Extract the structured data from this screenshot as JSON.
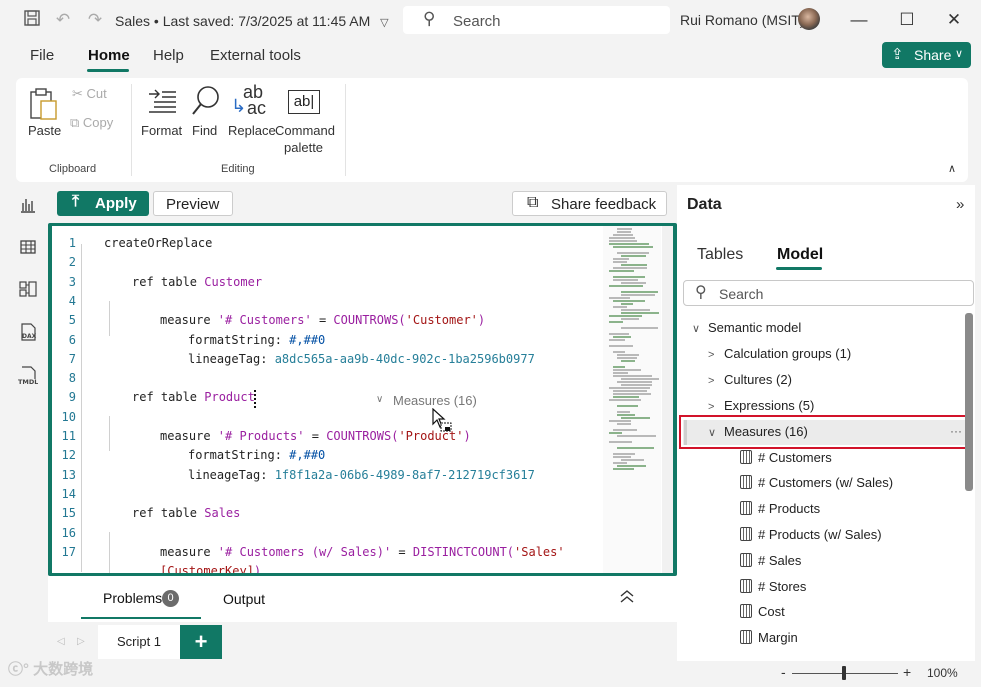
{
  "titlebar": {
    "title": "Sales • Last saved: 7/3/2025 at 11:45 AM",
    "dropdown_glyph": "▽",
    "search_placeholder": "Search",
    "user": "Rui Romano (MSIT)",
    "icons": [
      "save-icon",
      "undo-icon",
      "redo-icon",
      "search-icon",
      "avatar",
      "minimize-icon",
      "maximize-icon",
      "close-icon"
    ]
  },
  "menu": {
    "items": [
      "File",
      "Home",
      "Help",
      "External tools"
    ],
    "active": "Home",
    "share_label": "Share"
  },
  "ribbon": {
    "paste": "Paste",
    "cut": "Cut",
    "copy": "Copy",
    "clipboard_group": "Clipboard",
    "format": "Format",
    "find": "Find",
    "replace": "Replace",
    "command_palette_1": "Command",
    "command_palette_2": "palette",
    "editing_group": "Editing"
  },
  "toolbar": {
    "apply": "Apply",
    "preview": "Preview",
    "share_feedback": "Share feedback"
  },
  "editor": {
    "lines": [
      {
        "n": "1",
        "indent": 0,
        "parts": [
          [
            "kw",
            "createOrReplace"
          ]
        ]
      },
      {
        "n": "2",
        "indent": 0,
        "parts": []
      },
      {
        "n": "3",
        "indent": 1,
        "parts": [
          [
            "kw",
            "ref table "
          ],
          [
            "purple",
            "Customer"
          ]
        ]
      },
      {
        "n": "4",
        "indent": 0,
        "parts": []
      },
      {
        "n": "5",
        "indent": 2,
        "parts": [
          [
            "kw",
            "measure "
          ],
          [
            "purple",
            "'# Customers'"
          ],
          [
            "kw",
            " = "
          ],
          [
            "purple",
            "COUNTROWS("
          ],
          [
            "str",
            "'Customer'"
          ],
          [
            "purple",
            ")"
          ]
        ]
      },
      {
        "n": "6",
        "indent": 3,
        "parts": [
          [
            "kw",
            "formatString: "
          ],
          [
            "blue",
            "#,##0"
          ]
        ]
      },
      {
        "n": "7",
        "indent": 3,
        "parts": [
          [
            "kw",
            "lineageTag: "
          ],
          [
            "teal",
            "a8dc565a-aa9b-40dc-902c-1ba2596b0977"
          ]
        ]
      },
      {
        "n": "8",
        "indent": 0,
        "parts": []
      },
      {
        "n": "9",
        "indent": 1,
        "parts": [
          [
            "kw",
            "ref table "
          ],
          [
            "purple",
            "Product"
          ]
        ]
      },
      {
        "n": "10",
        "indent": 0,
        "parts": []
      },
      {
        "n": "11",
        "indent": 2,
        "parts": [
          [
            "kw",
            "measure "
          ],
          [
            "purple",
            "'# Products'"
          ],
          [
            "kw",
            " = "
          ],
          [
            "purple",
            "COUNTROWS("
          ],
          [
            "str",
            "'Product'"
          ],
          [
            "purple",
            ")"
          ]
        ]
      },
      {
        "n": "12",
        "indent": 3,
        "parts": [
          [
            "kw",
            "formatString: "
          ],
          [
            "blue",
            "#,##0"
          ]
        ]
      },
      {
        "n": "13",
        "indent": 3,
        "parts": [
          [
            "kw",
            "lineageTag: "
          ],
          [
            "teal",
            "1f8f1a2a-06b6-4989-8af7-212719cf3617"
          ]
        ]
      },
      {
        "n": "14",
        "indent": 0,
        "parts": []
      },
      {
        "n": "15",
        "indent": 1,
        "parts": [
          [
            "kw",
            "ref table "
          ],
          [
            "purple",
            "Sales"
          ]
        ]
      },
      {
        "n": "16",
        "indent": 0,
        "parts": []
      },
      {
        "n": "17",
        "indent": 2,
        "parts": [
          [
            "kw",
            "measure "
          ],
          [
            "purple",
            "'# Customers (w/ Sales)'"
          ],
          [
            "kw",
            " = "
          ],
          [
            "purple",
            "DISTINCTCOUNT("
          ],
          [
            "str",
            "'Sales'"
          ]
        ]
      },
      {
        "n": "",
        "indent": 2,
        "parts": [
          [
            "str",
            "[CustomerKey]"
          ],
          [
            "purple",
            ")"
          ]
        ]
      }
    ],
    "drag_tooltip": "Measures (16)"
  },
  "bottom": {
    "problems": "Problems",
    "problems_count": "0",
    "output": "Output",
    "script_tab": "Script 1",
    "add": "+"
  },
  "data_pane": {
    "title": "Data",
    "tabs": [
      "Tables",
      "Model"
    ],
    "active_tab": "Model",
    "search_placeholder": "Search",
    "tree": [
      {
        "label": "Semantic model",
        "level": 0,
        "chev": "∨"
      },
      {
        "label": "Calculation groups (1)",
        "level": 1,
        "chev": ">"
      },
      {
        "label": "Cultures (2)",
        "level": 1,
        "chev": ">"
      },
      {
        "label": "Expressions (5)",
        "level": 1,
        "chev": ">"
      },
      {
        "label": "Measures (16)",
        "level": 1,
        "chev": "∨",
        "selected": true
      },
      {
        "label": "# Customers",
        "level": 2,
        "icon": "calculator-icon"
      },
      {
        "label": "# Customers (w/ Sales)",
        "level": 2,
        "icon": "calculator-icon"
      },
      {
        "label": "# Products",
        "level": 2,
        "icon": "calculator-icon"
      },
      {
        "label": "# Products (w/ Sales)",
        "level": 2,
        "icon": "calculator-icon"
      },
      {
        "label": "# Sales",
        "level": 2,
        "icon": "calculator-icon"
      },
      {
        "label": "# Stores",
        "level": 2,
        "icon": "calculator-icon"
      },
      {
        "label": "Cost",
        "level": 2,
        "icon": "calculator-icon"
      },
      {
        "label": "Margin",
        "level": 2,
        "icon": "calculator-icon"
      }
    ]
  },
  "status": {
    "zoom": "100%",
    "watermark": "大数跨境"
  },
  "colors": {
    "accent": "#117865",
    "highlight": "#d2132a"
  }
}
